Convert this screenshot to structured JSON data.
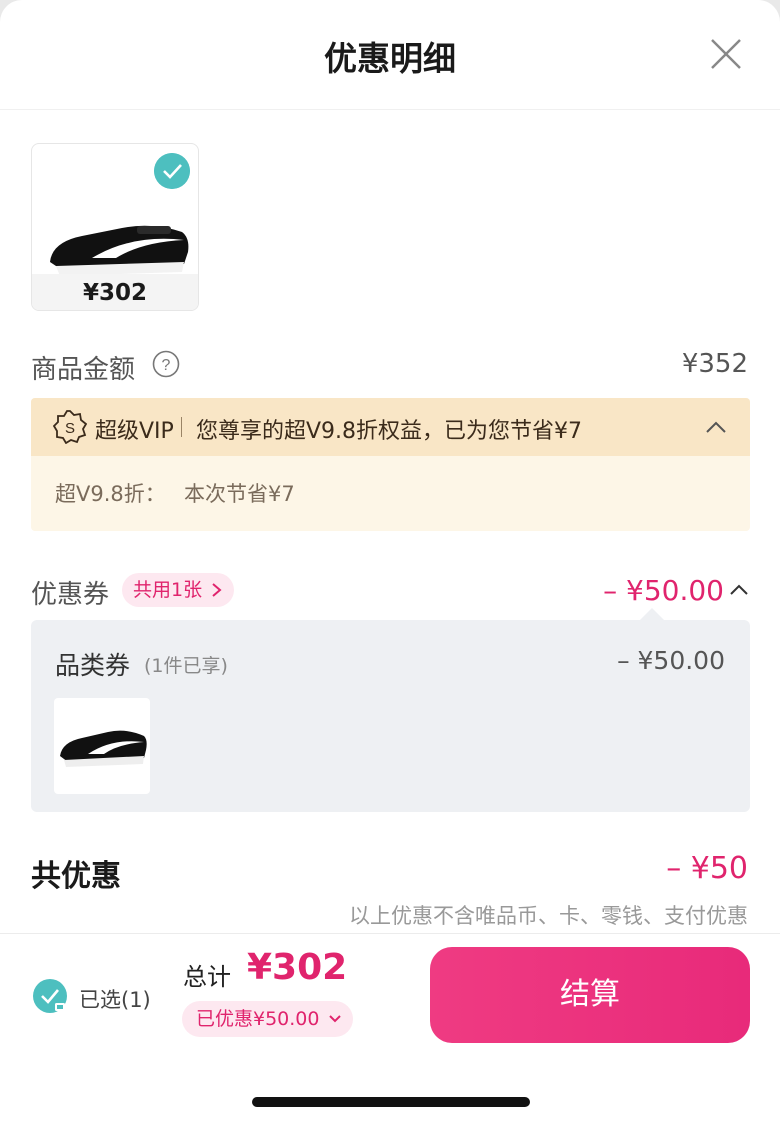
{
  "header": {
    "title": "优惠明细"
  },
  "product": {
    "price": "¥302"
  },
  "amount": {
    "label": "商品金额",
    "value": "¥352"
  },
  "vip": {
    "name": "超级VIP",
    "description": "您尊享的超V9.8折权益，已为您节省¥7",
    "detail_label": "超V9.8折：",
    "detail_value": "本次节省¥7"
  },
  "coupon": {
    "label": "优惠券",
    "pill": "共用1张",
    "total": "– ¥50.00",
    "category_label": "品类券",
    "category_sub": "(1件已享)",
    "category_value": "– ¥50.00"
  },
  "total_discount": {
    "label": "共优惠",
    "value": "– ¥50",
    "note": "以上优惠不含唯品币、卡、零钱、支付优惠"
  },
  "bottom": {
    "selected": "已选(1)",
    "sum_label": "总计",
    "sum_value": "¥302",
    "saved": "已优惠¥50.00",
    "checkout": "结算"
  },
  "colors": {
    "accent": "#e0246d",
    "teal": "#4dbfbf",
    "vip_bar": "#f9e6c6",
    "vip_bg": "#fdf6e7"
  }
}
